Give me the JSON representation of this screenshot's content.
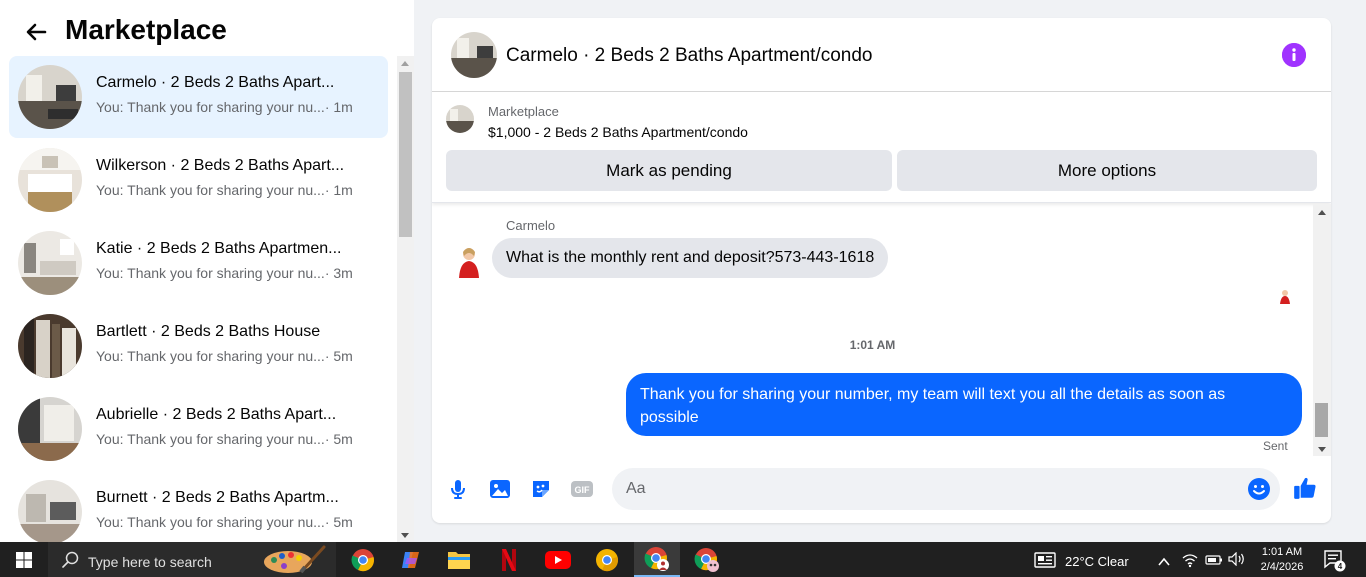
{
  "sidebar": {
    "title": "Marketplace",
    "conversations": [
      {
        "name": "Carmelo · 2 Beds 2 Baths Apart...",
        "preview": "You: Thank you for sharing your nu...",
        "time": "· 1m",
        "active": true
      },
      {
        "name": "Wilkerson · 2 Beds 2 Baths Apart...",
        "preview": "You: Thank you for sharing your nu...",
        "time": "· 1m",
        "active": false
      },
      {
        "name": "Katie · 2 Beds 2 Baths Apartmen...",
        "preview": "You: Thank you for sharing your nu...",
        "time": "· 3m",
        "active": false
      },
      {
        "name": "Bartlett · 2 Beds 2 Baths House",
        "preview": "You: Thank you for sharing your nu...",
        "time": "· 5m",
        "active": false
      },
      {
        "name": "Aubrielle · 2 Beds 2 Baths Apart...",
        "preview": "You: Thank you for sharing your nu...",
        "time": "· 5m",
        "active": false
      },
      {
        "name": "Burnett · 2 Beds 2 Baths Apartm...",
        "preview": "You: Thank you for sharing your nu...",
        "time": "· 5m",
        "active": false
      }
    ]
  },
  "chat": {
    "title": "Carmelo · 2 Beds 2 Baths Apartment/condo",
    "listing": {
      "source": "Marketplace",
      "price_title": "$1,000 - 2 Beds 2 Baths Apartment/condo",
      "mark_pending_label": "Mark as pending",
      "more_options_label": "More options"
    },
    "messages": {
      "incoming_sender": "Carmelo",
      "incoming_text": "What is the monthly rent and deposit?573-443-1618",
      "timestamp": "1:01 AM",
      "outgoing_text": "Thank you for  sharing your number, my team will text you all the details as soon as possible",
      "status": "Sent"
    },
    "composer": {
      "placeholder": "Aa"
    },
    "colors": {
      "accent": "#0a66ff",
      "info": "#a033ff",
      "active_conversation": "#e7f3ff"
    }
  },
  "taskbar": {
    "search_placeholder": "Type here to search",
    "weather": "22°C  Clear",
    "time": "1:01 AM",
    "date": "2/4/2026",
    "notification_count": "4",
    "apps": [
      "chrome-icon",
      "copilot-icon",
      "file-explorer-icon",
      "netflix-icon",
      "youtube-icon",
      "chrome-canary-icon",
      "chrome-profile-icon",
      "chrome-profile-2-icon"
    ]
  }
}
